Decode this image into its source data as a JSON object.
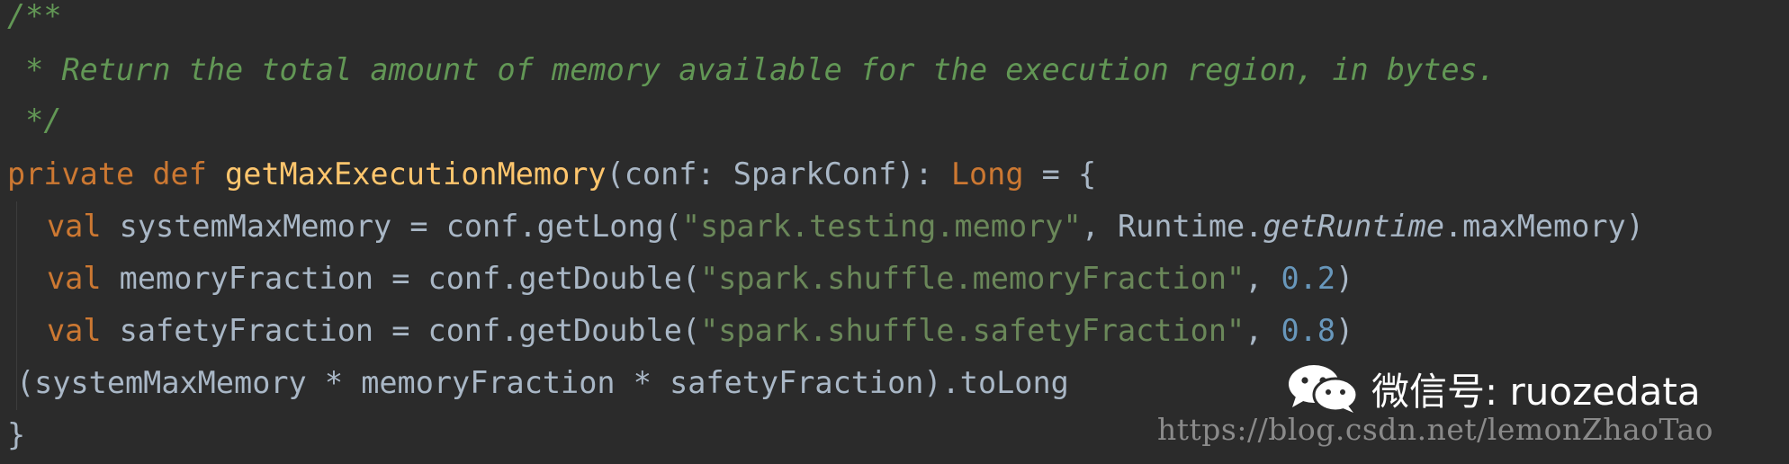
{
  "code": {
    "comment_open": "/**",
    "comment_body": " * Return the total amount of memory available for the execution region, in bytes.",
    "comment_close": " */",
    "decl": {
      "kw_private": "private",
      "kw_def": "def",
      "fn_name": "getMaxExecutionMemory",
      "params": "(conf: SparkConf): ",
      "ret_type": "Long",
      "tail": " = {"
    },
    "line1": {
      "kw": "val",
      "a": " systemMaxMemory = conf.getLong(",
      "str": "\"spark.testing.memory\"",
      "b": ", Runtime.",
      "it": "getRuntime",
      "c": ".maxMemory)"
    },
    "line2": {
      "kw": "val",
      "a": " memoryFraction = conf.getDouble(",
      "str": "\"spark.shuffle.memoryFraction\"",
      "b": ", ",
      "num": "0.2",
      "c": ")"
    },
    "line3": {
      "kw": "val",
      "a": " safetyFraction = conf.getDouble(",
      "str": "\"spark.shuffle.safetyFraction\"",
      "b": ", ",
      "num": "0.8",
      "c": ")"
    },
    "line4": "(systemMaxMemory * memoryFraction * safetyFraction).toLong",
    "close": "}"
  },
  "watermark": {
    "label": "微信号: ruozedata",
    "url": "https://blog.csdn.net/lemonZhaoTao",
    "icon": "wechat-icon"
  },
  "colors": {
    "background": "#2b2b2b",
    "keyword": "#cc7832",
    "function": "#ffc66d",
    "string": "#6a8759",
    "number": "#6897bb",
    "comment": "#629755",
    "text": "#a9b7c6"
  }
}
